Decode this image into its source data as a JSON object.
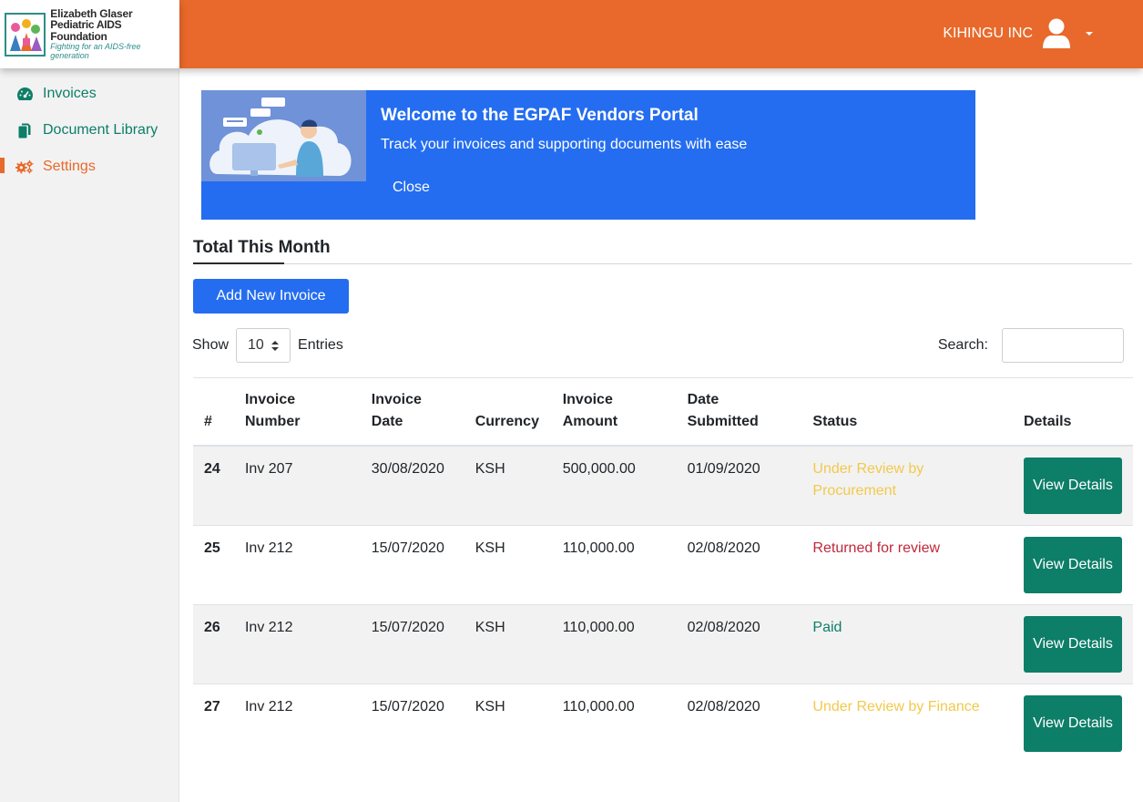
{
  "logo": {
    "line1": "Elizabeth Glaser",
    "line2": "Pediatric AIDS Foundation",
    "line3": "Fighting for an AIDS-free generation"
  },
  "header": {
    "user_name": "KIHINGU INC",
    "icon": "user-icon"
  },
  "sidebar": {
    "items": [
      {
        "label": "Invoices",
        "icon": "dashboard-icon"
      },
      {
        "label": "Document Library",
        "icon": "documents-icon"
      },
      {
        "label": "Settings",
        "icon": "gears-icon"
      }
    ]
  },
  "banner": {
    "title": "Welcome to the EGPAF Vendors Portal",
    "subtitle": "Track your invoices and supporting documents with ease",
    "close_label": "Close"
  },
  "section": {
    "title": "Total This Month",
    "add_label": "Add New Invoice"
  },
  "controls": {
    "show_label": "Show",
    "entries_value": "10",
    "entries_label": "Entries",
    "search_label": "Search:",
    "search_value": ""
  },
  "table": {
    "headers": {
      "index": "#",
      "invoice_number": "Invoice Number",
      "invoice_date": "Invoice Date",
      "currency": "Currency",
      "invoice_amount": "Invoice Amount",
      "date_submitted": "Date Submitted",
      "status": "Status",
      "details": "Details"
    },
    "view_label": "View Details",
    "rows": [
      {
        "index": "24",
        "invoice_number": "Inv 207",
        "invoice_date": "30/08/2020",
        "currency": "KSH",
        "invoice_amount": "500,000.00",
        "date_submitted": "01/09/2020",
        "status": "Under Review by Procurement"
      },
      {
        "index": "25",
        "invoice_number": "Inv 212",
        "invoice_date": "15/07/2020",
        "currency": "KSH",
        "invoice_amount": "110,000.00",
        "date_submitted": "02/08/2020",
        "status": "Returned for review"
      },
      {
        "index": "26",
        "invoice_number": "Inv 212",
        "invoice_date": "15/07/2020",
        "currency": "KSH",
        "invoice_amount": "110,000.00",
        "date_submitted": "02/08/2020",
        "status": "Paid"
      },
      {
        "index": "27",
        "invoice_number": "Inv 212",
        "invoice_date": "15/07/2020",
        "currency": "KSH",
        "invoice_amount": "110,000.00",
        "date_submitted": "02/08/2020",
        "status": "Under Review by Finance"
      }
    ]
  },
  "colors": {
    "brand_orange": "#e8692b",
    "primary_blue": "#246df0",
    "teal": "#0d7e68",
    "status_review": "#f2c94c",
    "status_returned": "#c0283b",
    "status_paid": "#0d7e68"
  }
}
